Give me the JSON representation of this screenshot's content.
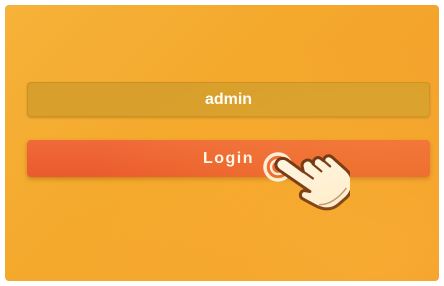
{
  "login_form": {
    "username_value": "admin",
    "login_label": "Login"
  },
  "colors": {
    "background": "#f4a92c",
    "field": "#d89f2c",
    "button": "#ec5e30",
    "text": "#ffffff"
  },
  "icons": {
    "cursor": "hand-pointer-icon"
  }
}
